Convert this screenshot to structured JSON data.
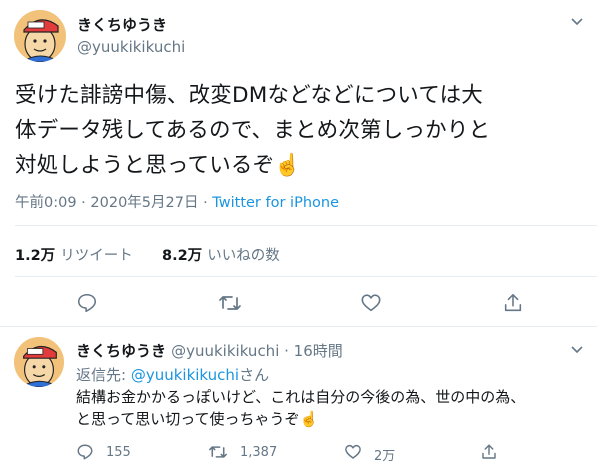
{
  "tweet": {
    "display_name": "きくちゆうき",
    "handle": "@yuukikikuchi",
    "text_lines": [
      "受けた誹謗中傷、改変DMなどなどについては大",
      "体データ残してあるので、まとめ次第しっかりと",
      "対処しようと思っているぞ☝️"
    ],
    "timestamp": "午前0:09 · 2020年5月27日",
    "source_separator": " · ",
    "source": "Twitter for iPhone",
    "retweet_count": "1.2万",
    "retweet_label": "リツイート",
    "like_count": "8.2万",
    "like_label": "いいねの数"
  },
  "reply": {
    "display_name": "きくちゆうき",
    "handle_time": "@yuukikikuchi · 16時間",
    "reply_prefix": "返信先: ",
    "reply_to_handle": "@yuukikikuchi",
    "reply_suffix": "さん",
    "text_lines": [
      "結構お金かかるっぽいけど、これは自分の今後の為、世の中の為、",
      "と思って思い切って使っちゃうぞ☝️"
    ],
    "reply_count": "155",
    "retweet_count": "1,387",
    "like_count": "2万"
  },
  "icons": [
    "chevron-down-icon",
    "reply-icon",
    "retweet-icon",
    "like-icon",
    "share-icon"
  ],
  "colors": {
    "link": "#1b95e0",
    "muted": "#657786",
    "divider": "#e6ecf0"
  }
}
